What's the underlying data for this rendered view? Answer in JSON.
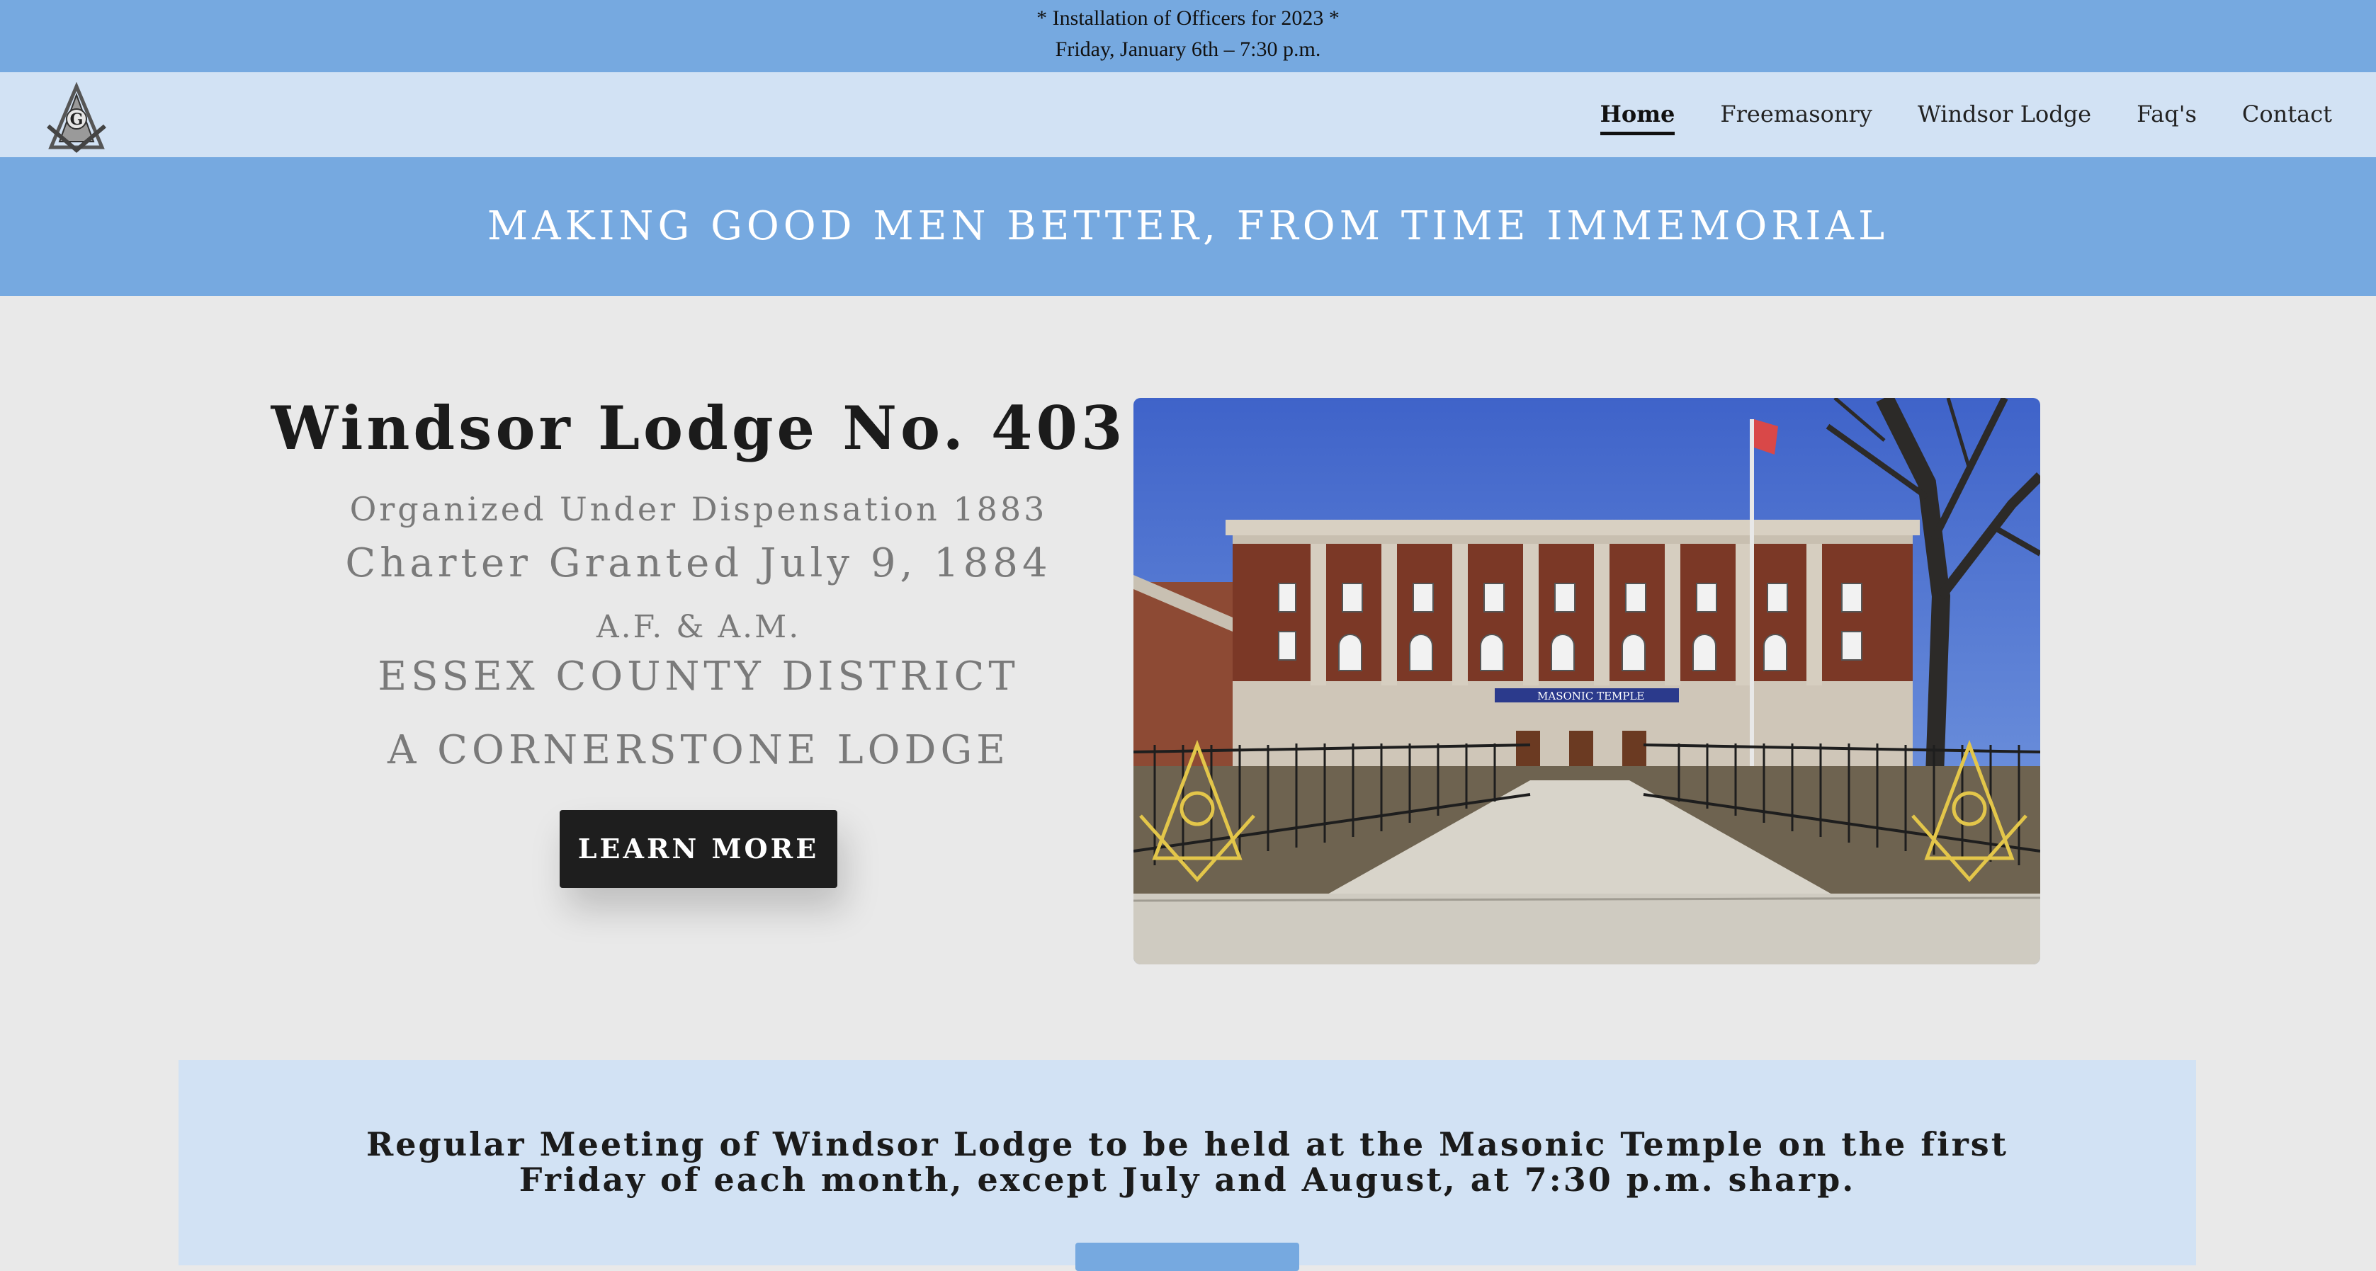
{
  "announcement": {
    "line1": "* Installation of Officers for 2023 *",
    "line2": "Friday, January 6th – 7:30 p.m."
  },
  "nav": {
    "logo_icon": "square-and-compass-icon",
    "items": [
      "Home",
      "Freemasonry",
      "Windsor Lodge",
      "Faq's",
      "Contact"
    ],
    "active": "Home"
  },
  "motto": "MAKING GOOD MEN BETTER, FROM TIME IMMEMORIAL",
  "intro": {
    "title": "Windsor Lodge No. 403",
    "organized": "Organized Under Dispensation 1883",
    "charter": "Charter Granted July 9, 1884",
    "rite": "A.F. & A.M.",
    "district": "ESSEX COUNTY DISTRICT",
    "cornerstone": "A CORNERSTONE LODGE",
    "button": "LEARN MORE"
  },
  "photo": {
    "banner": "MASONIC TEMPLE"
  },
  "notice": {
    "text": "Regular Meeting of Windsor Lodge to be held at the Masonic Temple on the first Friday of each month, except July and August, at 7:30 p.m. sharp."
  },
  "colors": {
    "accent_blue": "#76a9e0",
    "light_blue": "#d2e2f4",
    "page_bg": "#e9e9e9",
    "button_dark": "#1e1e1e"
  }
}
